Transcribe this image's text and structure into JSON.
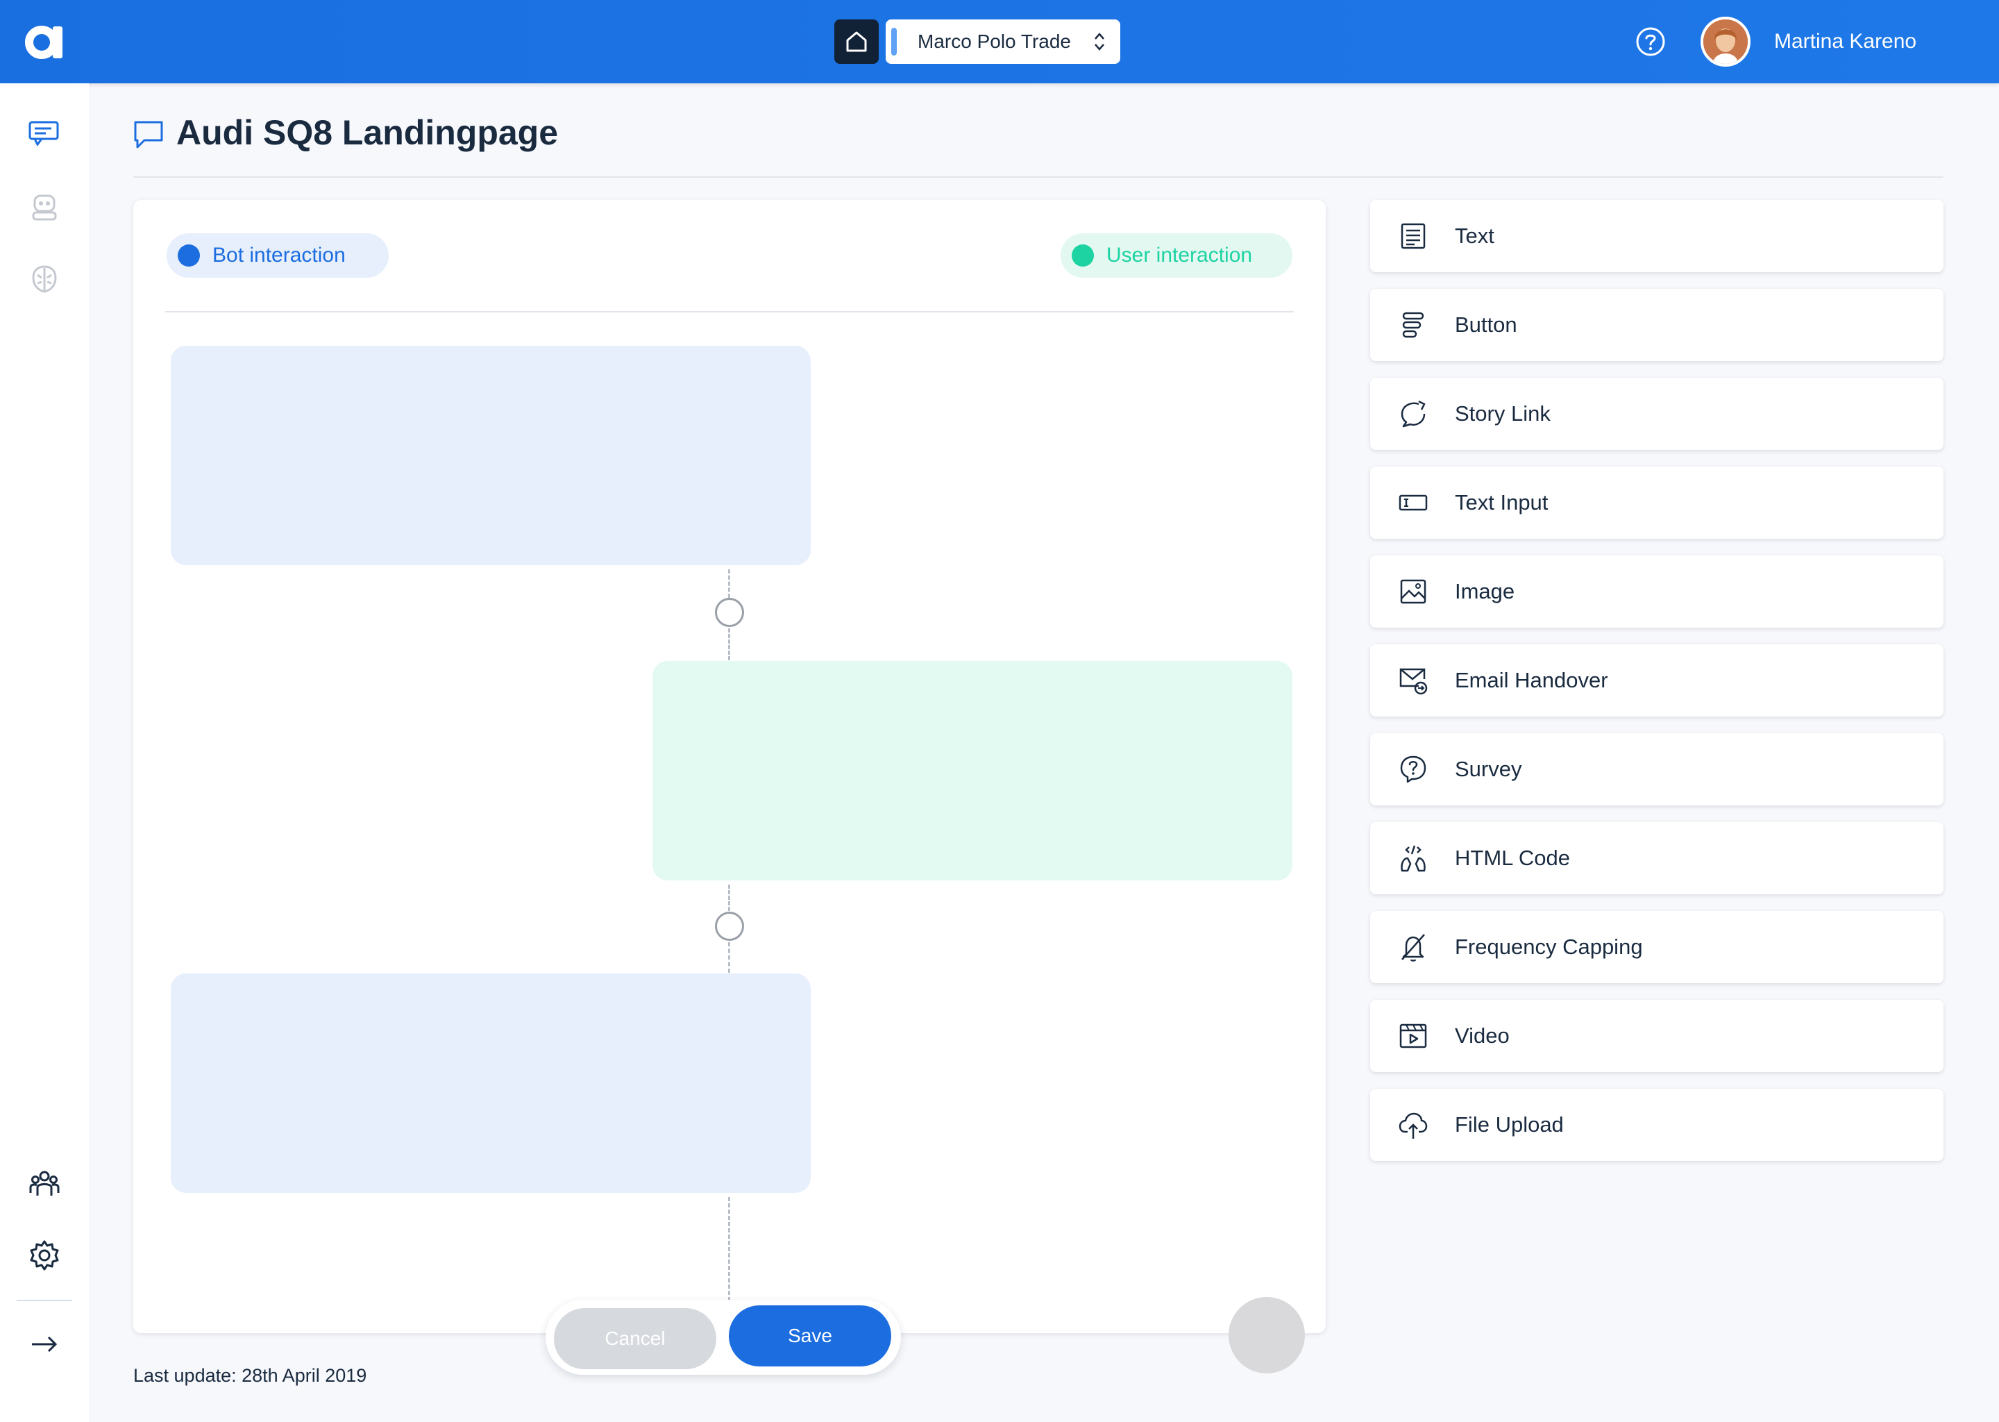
{
  "topbar": {
    "company": "Marco Polo Trade",
    "user_name": "Martina Kareno"
  },
  "page": {
    "title": "Audi SQ8 Landingpage",
    "last_update": "Last update: 28th April 2019"
  },
  "legend": {
    "bot": "Bot interaction",
    "user": "User interaction"
  },
  "actions": {
    "cancel": "Cancel",
    "save": "Save"
  },
  "palette": {
    "items": [
      {
        "label": "Text",
        "icon": "text-icon"
      },
      {
        "label": "Button",
        "icon": "button-icon"
      },
      {
        "label": "Story Link",
        "icon": "story-link-icon"
      },
      {
        "label": "Text Input",
        "icon": "text-input-icon"
      },
      {
        "label": "Image",
        "icon": "image-icon"
      },
      {
        "label": "Email Handover",
        "icon": "email-handover-icon"
      },
      {
        "label": "Survey",
        "icon": "survey-icon"
      },
      {
        "label": "HTML Code",
        "icon": "html-code-icon"
      },
      {
        "label": "Frequency Capping",
        "icon": "frequency-capping-icon"
      },
      {
        "label": "Video",
        "icon": "video-icon"
      },
      {
        "label": "File Upload",
        "icon": "file-upload-icon"
      }
    ]
  },
  "colors": {
    "brand": "#1c6ee0",
    "user_accent": "#1dd3a2",
    "bot_block": "#e6effb",
    "user_block": "#e3faf3"
  }
}
